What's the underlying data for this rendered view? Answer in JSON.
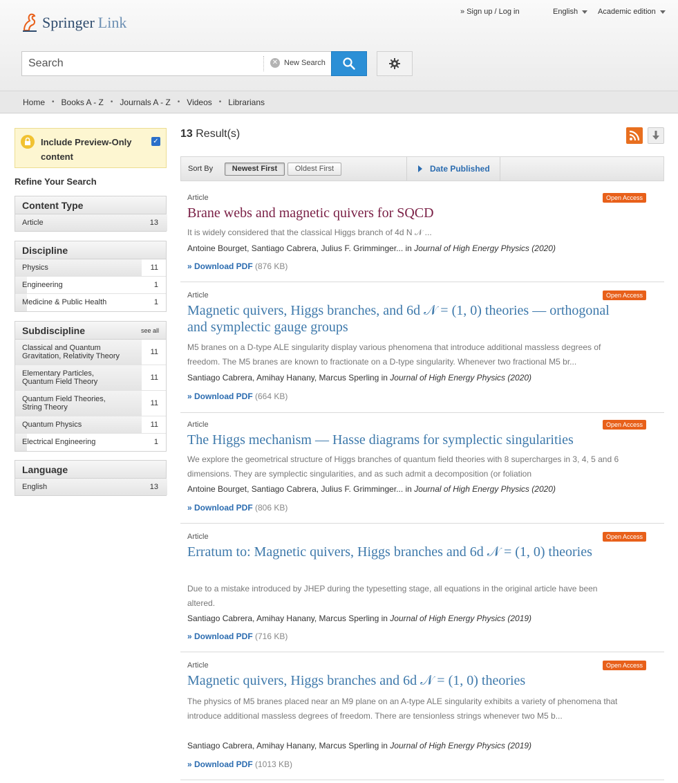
{
  "header": {
    "logo_brand": "Springer",
    "logo_sub": "Link",
    "signup_label": "» Sign up / Log in",
    "language_label": "English",
    "edition_label": "Academic edition"
  },
  "search": {
    "placeholder": "Search",
    "new_search_label": "New Search"
  },
  "nav": [
    "Home",
    "Books A - Z",
    "Journals A - Z",
    "Videos",
    "Librarians"
  ],
  "sidebar": {
    "preview_label": "Include Preview-Only content",
    "preview_checked": true,
    "refine_title": "Refine Your Search",
    "facets": [
      {
        "title": "Content Type",
        "see_all": "",
        "items": [
          {
            "label": "Article",
            "count": "13"
          }
        ]
      },
      {
        "title": "Discipline",
        "see_all": "",
        "items": [
          {
            "label": "Physics",
            "count": "11"
          },
          {
            "label": "Engineering",
            "count": "1"
          },
          {
            "label": "Medicine & Public Health",
            "count": "1"
          }
        ]
      },
      {
        "title": "Subdiscipline",
        "see_all": "see all",
        "items": [
          {
            "label": "Classical and Quantum Gravitation, Relativity Theory",
            "count": "11"
          },
          {
            "label": "Elementary Particles, Quantum Field Theory",
            "count": "11"
          },
          {
            "label": "Quantum Field Theories, String Theory",
            "count": "11"
          },
          {
            "label": "Quantum Physics",
            "count": "11"
          },
          {
            "label": "Electrical Engineering",
            "count": "1"
          }
        ]
      },
      {
        "title": "Language",
        "see_all": "",
        "items": [
          {
            "label": "English",
            "count": "13"
          }
        ]
      }
    ]
  },
  "results": {
    "count": "13",
    "count_suffix": " Result(s)",
    "sort_label": "Sort By",
    "sort_newest": "Newest First",
    "sort_oldest": "Oldest First",
    "date_published": "Date Published",
    "items": [
      {
        "type": "Article",
        "badge": "Open Access",
        "title": "Brane webs and magnetic quivers for SQCD",
        "snippet": "It is widely considered that the classical Higgs branch of 4d N 𝒩 ...",
        "authors": "Antoine Bourget, Santiago Cabrera, Julius F. Grimminger... ",
        "in": "in ",
        "journal": "Journal of High Energy Physics (2020)",
        "download": "» Download PDF",
        "size": " (876 KB)"
      },
      {
        "type": "Article",
        "badge": "Open Access",
        "title": "Magnetic quivers, Higgs branches, and 6d 𝒩 = (1, 0) theories — orthogonal and symplectic gauge groups",
        "snippet": "M5 branes on a D-type ALE singularity display various phenomena that introduce additional massless degrees of freedom. The M5 branes are known to fractionate on a D-type singularity. Whenever two fractional M5 br...",
        "authors": "Santiago Cabrera, Amihay Hanany, Marcus Sperling ",
        "in": "in ",
        "journal": "Journal of High Energy Physics (2020)",
        "download": "» Download PDF",
        "size": " (664 KB)"
      },
      {
        "type": "Article",
        "badge": "Open Access",
        "title": "The Higgs mechanism — Hasse diagrams for symplectic singularities",
        "snippet": "We explore the geometrical structure of Higgs branches of quantum field theories with 8 supercharges in 3, 4, 5 and 6 dimensions. They are symplectic singularities, and as such admit a decomposition (or foliation",
        "authors": "Antoine Bourget, Santiago Cabrera, Julius F. Grimminger... ",
        "in": "in ",
        "journal": "Journal of High Energy Physics (2020)",
        "download": "» Download PDF",
        "size": " (806 KB)"
      },
      {
        "type": "Article",
        "badge": "Open Access",
        "title": "Erratum to: Magnetic quivers, Higgs branches and 6d 𝒩 = (1, 0) theories",
        "snippet": "Due to a mistake introduced by JHEP during the typesetting stage, all equations in the original article have been altered.",
        "authors": "Santiago Cabrera, Amihay Hanany, Marcus Sperling ",
        "in": "in ",
        "journal": "Journal of High Energy Physics (2019)",
        "download": "» Download PDF",
        "size": " (716 KB)"
      },
      {
        "type": "Article",
        "badge": "Open Access",
        "title": "Magnetic quivers, Higgs branches and 6d 𝒩 = (1,  0) theories",
        "snippet": "The physics of M5 branes placed near an M9 plane on an A-type ALE singularity exhibits a variety of phenomena that introduce additional massless degrees of freedom. There are tensionless strings whenever two M5 b...",
        "authors": "Santiago Cabrera, Amihay Hanany, Marcus Sperling ",
        "in": "in ",
        "journal": "Journal of High Energy Physics (2019)",
        "download": "» Download PDF",
        "size": " (1013 KB)"
      }
    ]
  },
  "colors": {
    "accent": "#2b8fd6",
    "link": "#3e79ab",
    "visited": "#7a2046",
    "open_access": "#e8601a",
    "rss": "#e86f1f"
  }
}
